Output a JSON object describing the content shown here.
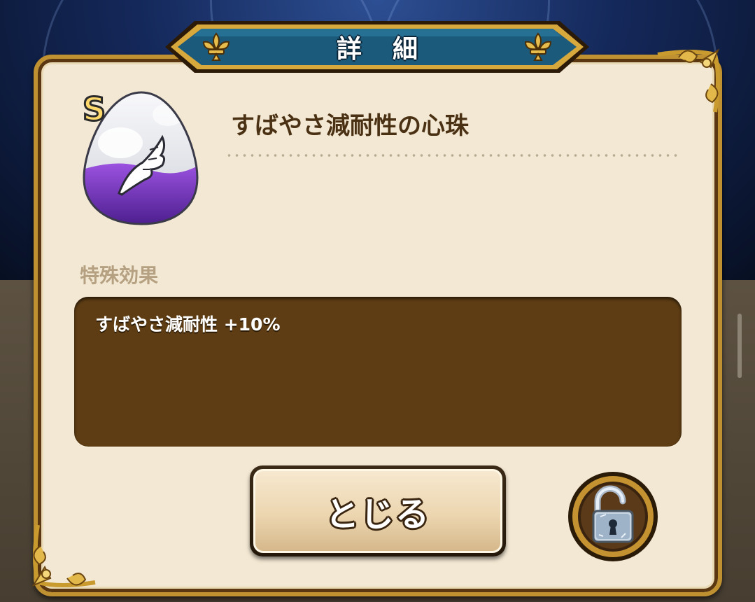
{
  "dialog": {
    "title": "詳細",
    "item": {
      "rank": "S",
      "name": "すばやさ減耐性の心珠",
      "icon": "wing-egg-jewel-icon"
    },
    "special_effect": {
      "label": "特殊効果",
      "text": "すばやさ減耐性 +10%"
    },
    "close_button_label": "とじる",
    "lock_button": {
      "icon": "unlocked-padlock-icon",
      "state": "unlocked"
    }
  },
  "colors": {
    "panel": "#f3e8d3",
    "frame_gold": "#c09130",
    "title_plate": "#1b5a7a",
    "effect_box": "#5e3d14",
    "item_name": "#4a3114",
    "section_label": "#b5a182"
  }
}
